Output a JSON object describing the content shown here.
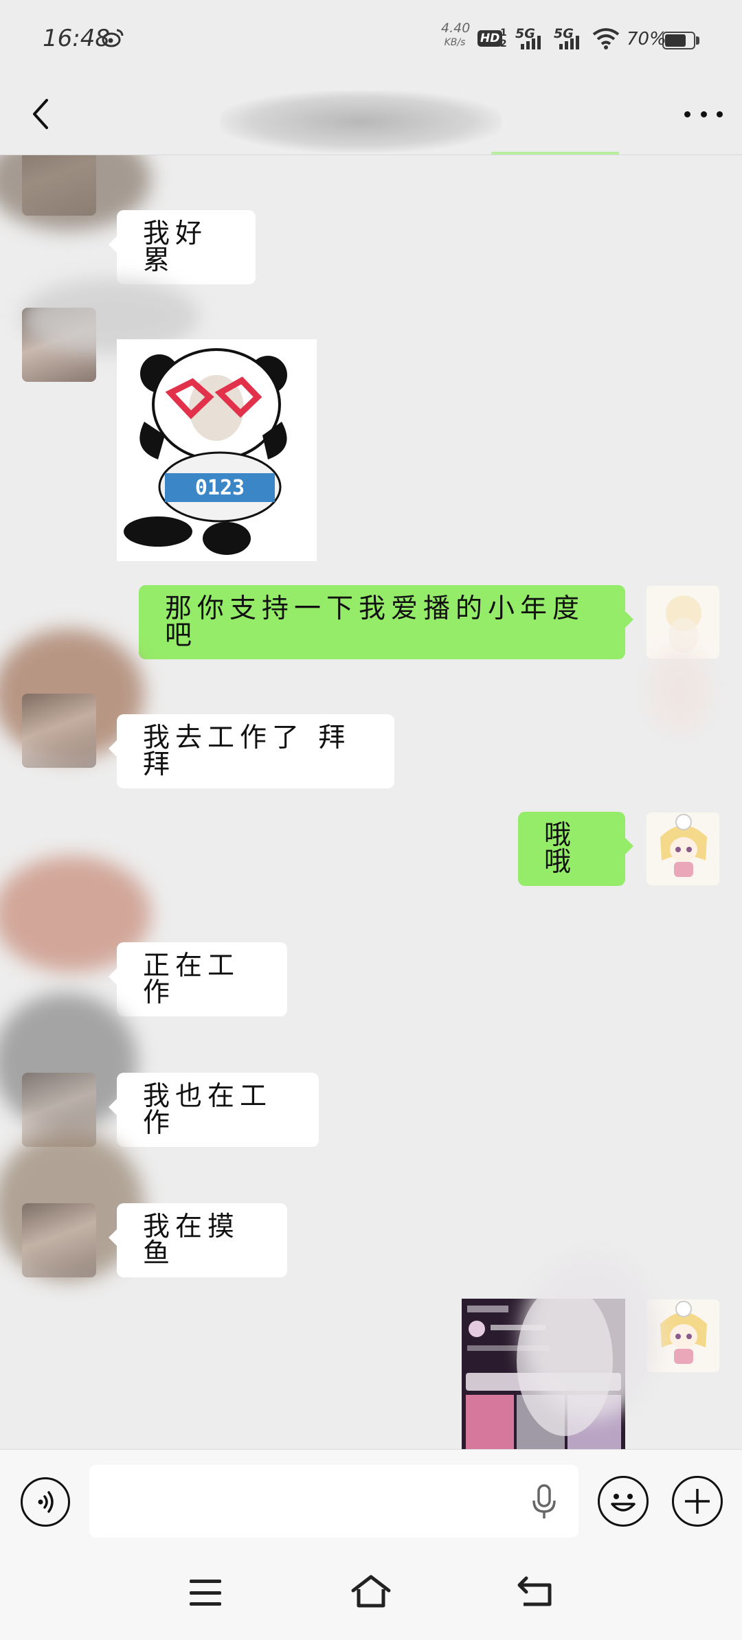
{
  "status_bar": {
    "time": "16:48",
    "net_speed_value": "4.40",
    "net_speed_unit": "KB/s",
    "hd_label": "HD",
    "hd_sims": "1\n2",
    "net1": "5G",
    "net2": "5G",
    "battery": "70%"
  },
  "header": {
    "title": "",
    "more_label": "more"
  },
  "messages": [
    {
      "side": "in",
      "type": "text",
      "text": "我好累"
    },
    {
      "side": "in",
      "type": "sticker",
      "sticker_text": "0123"
    },
    {
      "side": "out",
      "type": "text",
      "text": "那你支持一下我爱播的小年度吧"
    },
    {
      "side": "in",
      "type": "text",
      "text": "我去工作了 拜拜"
    },
    {
      "side": "out",
      "type": "text",
      "text": "哦哦"
    },
    {
      "side": "in",
      "type": "text",
      "text": "正在工作"
    },
    {
      "side": "in",
      "type": "text",
      "text": "我也在工作"
    },
    {
      "side": "in",
      "type": "text",
      "text": "我在摸鱼"
    },
    {
      "side": "out",
      "type": "image"
    }
  ],
  "input_bar": {
    "voice_icon": "voice-icon",
    "input_value": "",
    "mic_icon": "mic-icon",
    "emoji_icon": "emoji-icon",
    "plus_icon": "plus-icon"
  },
  "colors": {
    "bg": "#ededed",
    "outgoing_bubble": "#95ec69",
    "incoming_bubble": "#ffffff"
  }
}
